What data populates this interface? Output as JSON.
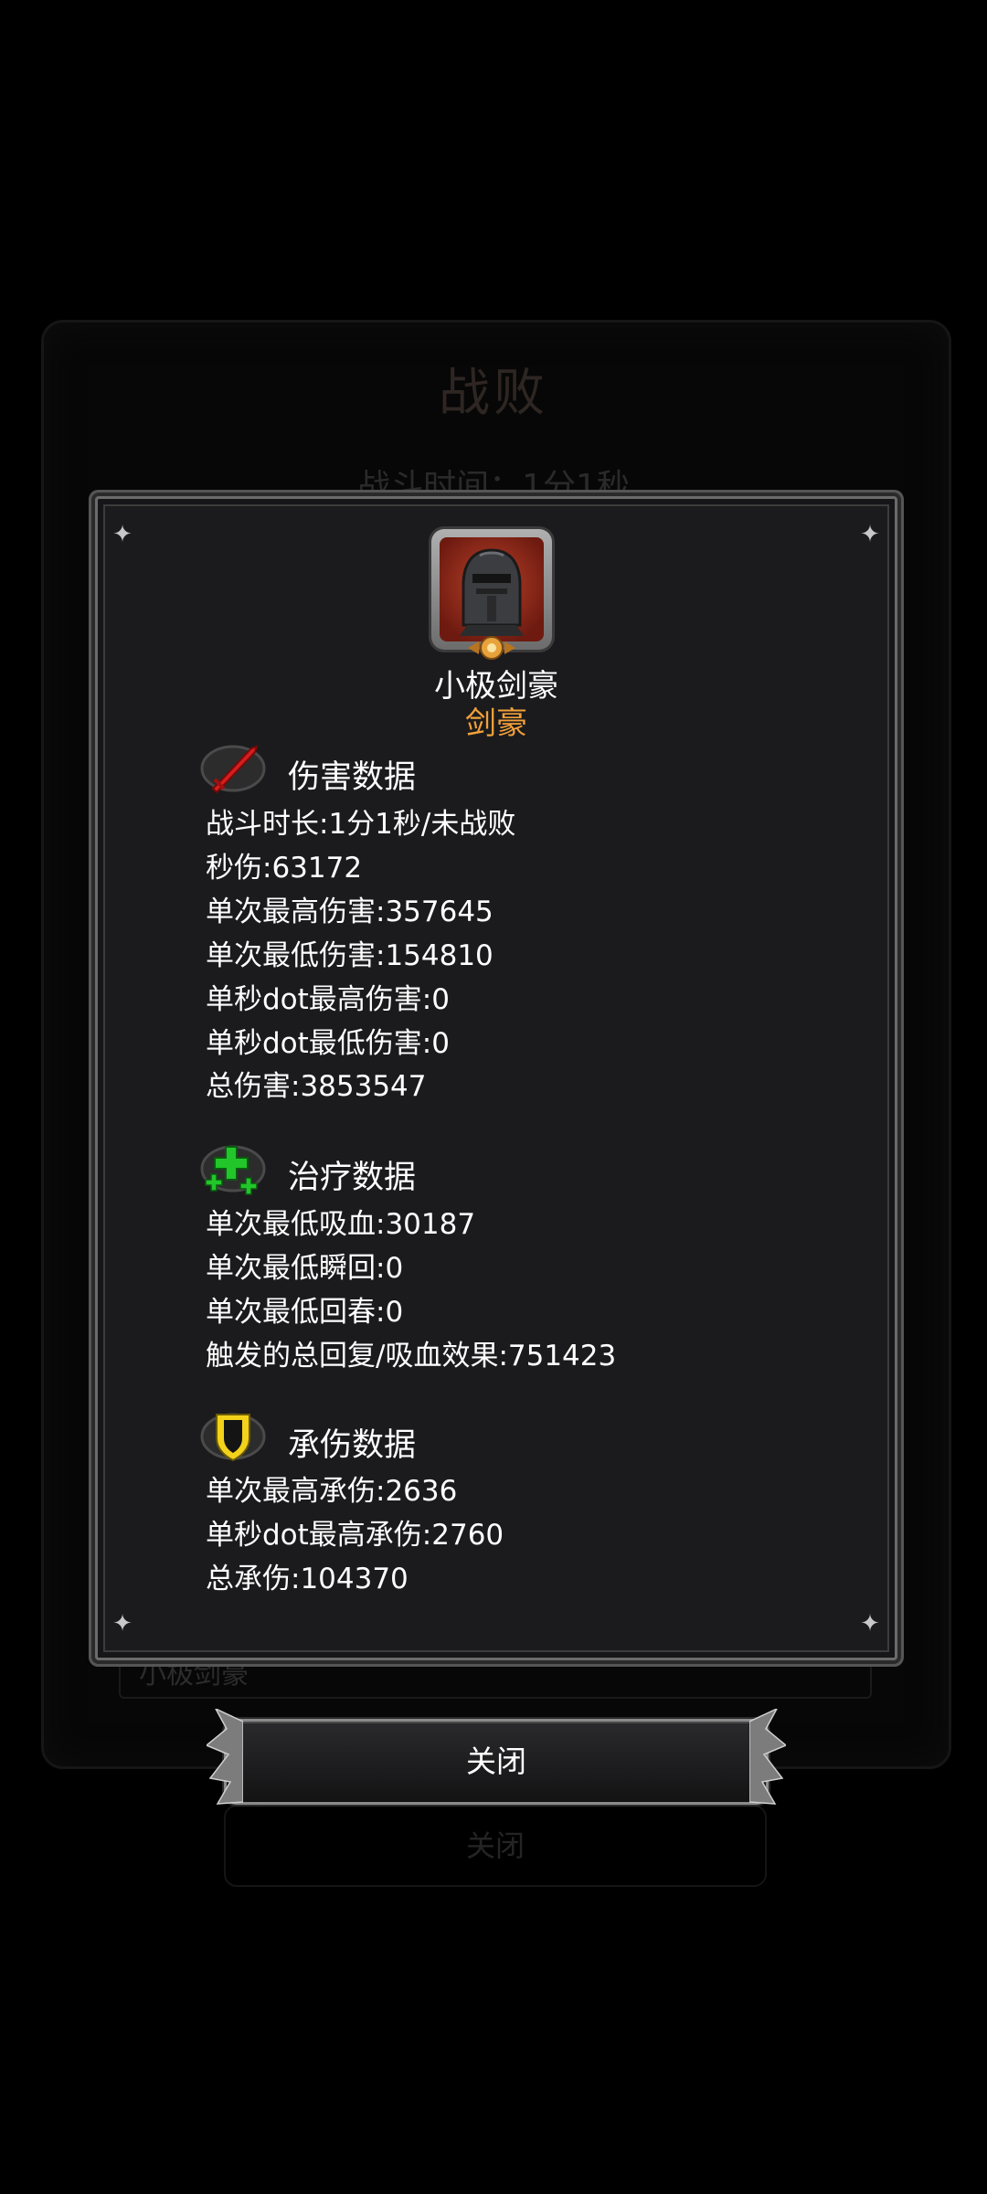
{
  "background": {
    "title": "战败",
    "battle_time": "战斗时间：1分1秒",
    "name_field": "小极剑豪",
    "close_label": "关闭"
  },
  "character": {
    "name": "小极剑豪",
    "class": "剑豪",
    "icon": "knight-helmet-icon"
  },
  "sections": {
    "damage": {
      "icon": "red-sword-icon",
      "title": "伤害数据",
      "stats": [
        "战斗时长:1分1秒/未战败",
        "秒伤:63172",
        "单次最高伤害:357645",
        "单次最低伤害:154810",
        "单秒dot最高伤害:0",
        "单秒dot最低伤害:0",
        "总伤害:3853547"
      ]
    },
    "heal": {
      "icon": "green-plus-icon",
      "title": "治疗数据",
      "stats": [
        "单次最低吸血:30187",
        "单次最低瞬回:0",
        "单次最低回春:0",
        "触发的总回复/吸血效果:751423"
      ]
    },
    "tank": {
      "icon": "yellow-shield-icon",
      "title": "承伤数据",
      "stats": [
        "单次最高承伤:2636",
        "单秒dot最高承伤:2760",
        "总承伤:104370"
      ]
    }
  },
  "buttons": {
    "close_label": "关闭"
  },
  "colors": {
    "class_text": "#f2a13a",
    "panel_bg": "#1b1b1d",
    "text": "#ffffff"
  }
}
